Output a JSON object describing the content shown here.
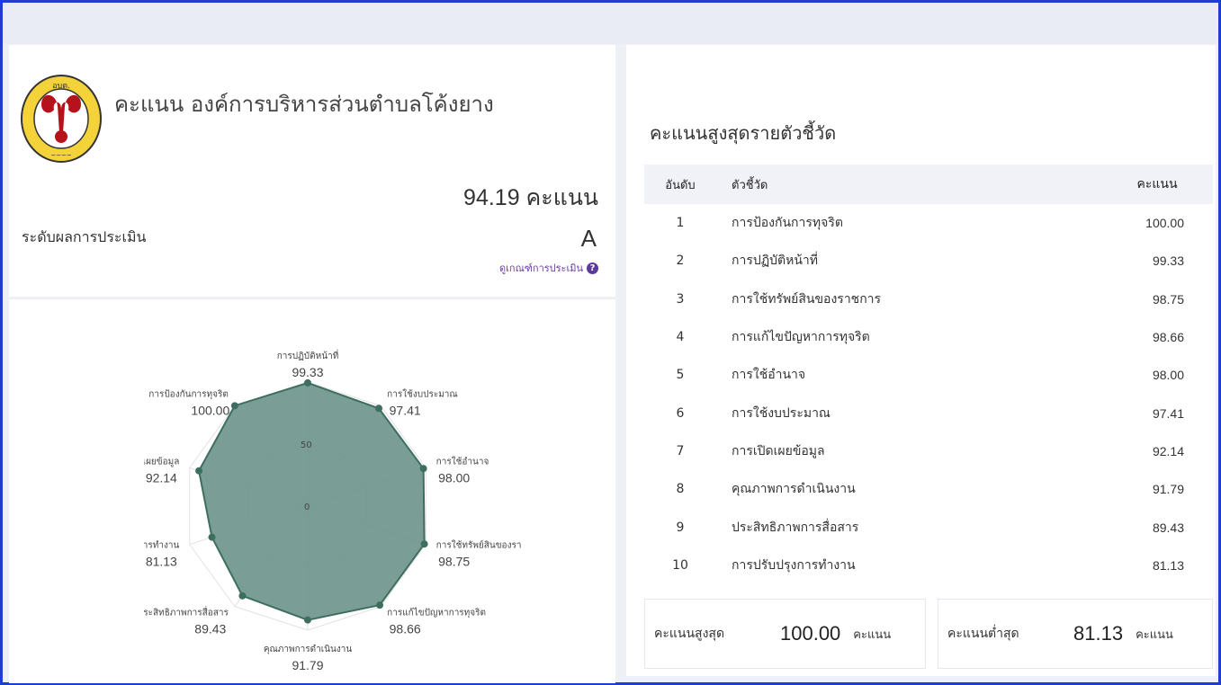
{
  "header": {
    "title": "คะแนน องค์การบริหารส่วนตำบลโค้งยาง",
    "score_text": "94.19 คะแนน",
    "level_label": "ระดับผลการประเมิน",
    "grade": "A",
    "criteria_link": "ดูเกณฑ์การประเมิน"
  },
  "radar": {
    "axis_ticks": [
      "0",
      "50"
    ],
    "indicators": [
      {
        "label": "การปฏิบัติหน้าที่",
        "value": "99.33",
        "score": 99.33
      },
      {
        "label": "การใช้งบประมาณ",
        "value": "97.41",
        "score": 97.41
      },
      {
        "label": "การใช้อำนาจ",
        "value": "98.00",
        "score": 98.0
      },
      {
        "label": "การใช้ทรัพย์สินของราชการ",
        "value": "98.75",
        "score": 98.75
      },
      {
        "label": "การแก้ไขปัญหาการทุจริต",
        "value": "98.66",
        "score": 98.66
      },
      {
        "label": "คุณภาพการดำเนินงาน",
        "value": "91.79",
        "score": 91.79
      },
      {
        "label": "ประสิทธิภาพการสื่อสาร",
        "value": "89.43",
        "score": 89.43
      },
      {
        "label": "การปรับปรุงการทำงาน",
        "value": "81.13",
        "score": 81.13
      },
      {
        "label": "การเปิดเผยข้อมูล",
        "value": "92.14",
        "score": 92.14
      },
      {
        "label": "การป้องกันการทุจริต",
        "value": "100.00",
        "score": 100.0
      }
    ],
    "fill_color": "#6b9389",
    "stroke_color": "#3d6e5f"
  },
  "ranking": {
    "title": "คะแนนสูงสุดรายตัวชี้วัด",
    "columns": [
      "อันดับ",
      "ตัวชี้วัด",
      "คะแนน"
    ],
    "rows": [
      {
        "rank": "1",
        "name": "การป้องกันการทุจริต",
        "score": "100.00"
      },
      {
        "rank": "2",
        "name": "การปฏิบัติหน้าที่",
        "score": "99.33"
      },
      {
        "rank": "3",
        "name": "การใช้ทรัพย์สินของราชการ",
        "score": "98.75"
      },
      {
        "rank": "4",
        "name": "การแก้ไขปัญหาการทุจริต",
        "score": "98.66"
      },
      {
        "rank": "5",
        "name": "การใช้อำนาจ",
        "score": "98.00"
      },
      {
        "rank": "6",
        "name": "การใช้งบประมาณ",
        "score": "97.41"
      },
      {
        "rank": "7",
        "name": "การเปิดเผยข้อมูล",
        "score": "92.14"
      },
      {
        "rank": "8",
        "name": "คุณภาพการดำเนินงาน",
        "score": "91.79"
      },
      {
        "rank": "9",
        "name": "ประสิทธิภาพการสื่อสาร",
        "score": "89.43"
      },
      {
        "rank": "10",
        "name": "การปรับปรุงการทำงาน",
        "score": "81.13"
      }
    ]
  },
  "summary": {
    "max_label": "คะแนนสูงสุด",
    "max_value": "100.00",
    "min_label": "คะแนนต่ำสุด",
    "min_value": "81.13",
    "unit": "คะแนน"
  },
  "logo": {
    "ring_color": "#f3d23a",
    "emblem_color": "#b5121b"
  }
}
